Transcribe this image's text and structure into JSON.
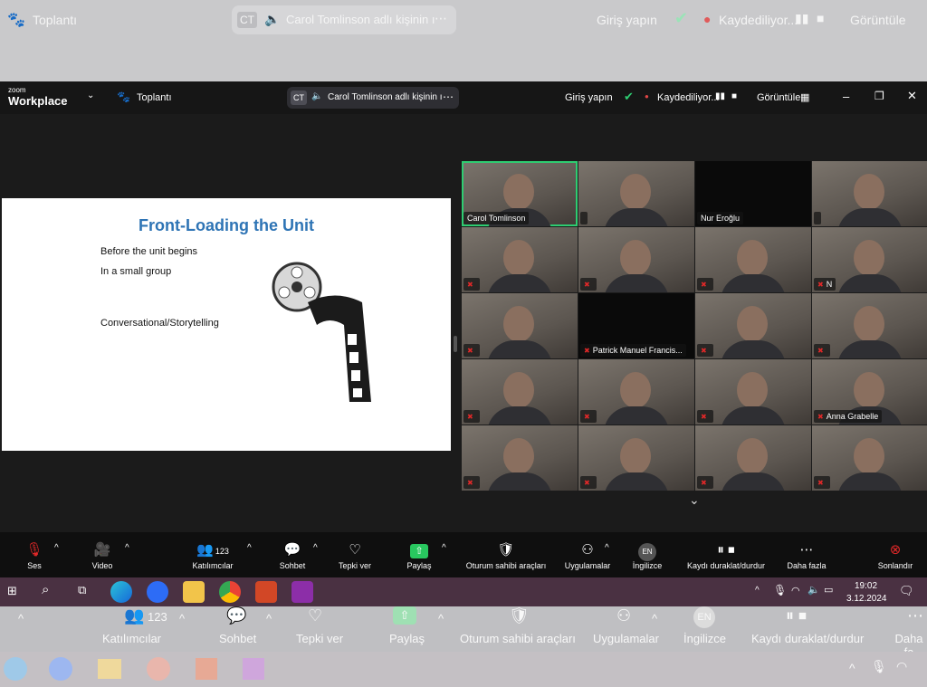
{
  "ghost_top": {
    "app_label": "Toplantı",
    "speaker_initials": "CT",
    "speaker_text": "Carol Tomlinson adlı kişinin ı",
    "signin": "Giriş yapın",
    "recording": "Kaydediliyor...",
    "view": "Görüntüle"
  },
  "zoom_top": {
    "brand_top": "zoom",
    "brand_bottom": "Workplace",
    "meeting_label": "Toplantı",
    "speaker_initials": "CT",
    "speaker_text": "Carol Tomlinson adlı kişinin ı",
    "signin": "Giriş yapın",
    "recording": "Kaydediliyor...",
    "view": "Görüntüle"
  },
  "slide": {
    "title": "Front-Loading the Unit",
    "lines": [
      "Before the unit begins",
      "In a small group",
      "Conversational/Storytelling"
    ]
  },
  "participants": [
    {
      "name": "Carol Tomlinson",
      "muted": false,
      "video": true,
      "active": true
    },
    {
      "name": "",
      "muted": false,
      "video": true
    },
    {
      "name": "Nur Eroğlu",
      "muted": false,
      "video": false
    },
    {
      "name": "",
      "muted": false,
      "video": true
    },
    {
      "name": "",
      "muted": true,
      "video": true
    },
    {
      "name": "",
      "muted": true,
      "video": true
    },
    {
      "name": "",
      "muted": true,
      "video": true
    },
    {
      "name": "N",
      "muted": true,
      "video": true
    },
    {
      "name": "",
      "muted": true,
      "video": true
    },
    {
      "name": "Patrick Manuel Francis...",
      "muted": true,
      "video": false
    },
    {
      "name": "",
      "muted": true,
      "video": true
    },
    {
      "name": "",
      "muted": true,
      "video": true
    },
    {
      "name": "",
      "muted": true,
      "video": true
    },
    {
      "name": "",
      "muted": true,
      "video": true
    },
    {
      "name": "",
      "muted": true,
      "video": true
    },
    {
      "name": "Anna Grabelle",
      "muted": true,
      "video": true
    },
    {
      "name": "",
      "muted": true,
      "video": true
    },
    {
      "name": "",
      "muted": true,
      "video": true
    },
    {
      "name": "",
      "muted": true,
      "video": true
    },
    {
      "name": "",
      "muted": true,
      "video": true
    }
  ],
  "toolbar": {
    "audio": "Ses",
    "video": "Video",
    "participants": "Katılımcılar",
    "participants_count": "123",
    "chat": "Sohbet",
    "react": "Tepki ver",
    "share": "Paylaş",
    "host_tools": "Oturum sahibi araçları",
    "apps": "Uygulamalar",
    "lang_badge": "EN",
    "lang": "İngilizce",
    "record": "Kaydı duraklat/durdur",
    "more": "Daha fazla",
    "end": "Sonlandır"
  },
  "taskbar": {
    "time": "19:02",
    "date": "3.12.2024"
  },
  "ghost_bottom": {
    "participants": "Katılımcılar",
    "count": "123",
    "chat": "Sohbet",
    "react": "Tepki ver",
    "share": "Paylaş",
    "host_tools": "Oturum sahibi araçları",
    "apps": "Uygulamalar",
    "lang_badge": "EN",
    "lang": "İngilizce",
    "record": "Kaydı duraklat/durdur",
    "more": "Daha fa"
  },
  "colors": {
    "accent_green": "#2ecc71",
    "slide_title": "#2e74b5",
    "end_red": "#e02828"
  }
}
